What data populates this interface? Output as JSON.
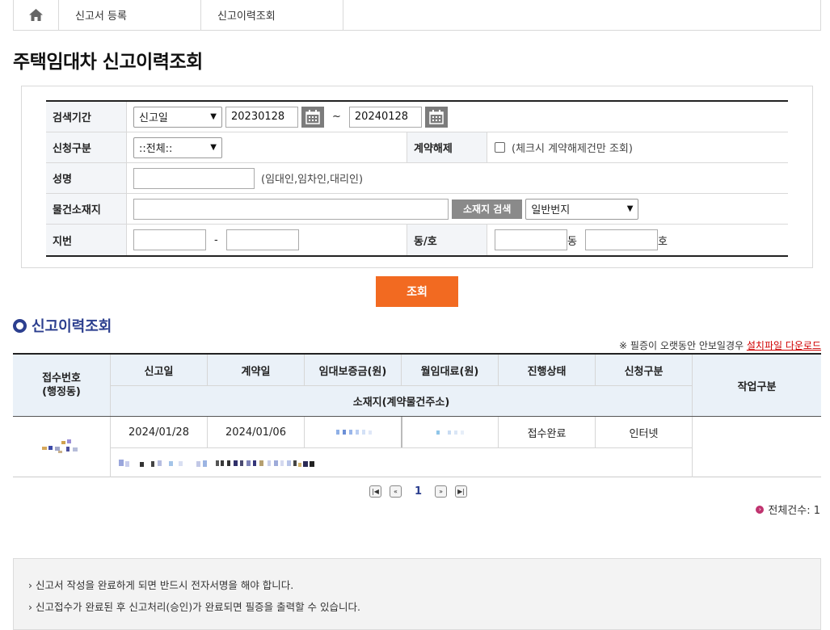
{
  "breadcrumb": {
    "items": [
      "신고서 등록",
      "신고이력조회"
    ]
  },
  "page_title": "주택임대차 신고이력조회",
  "search": {
    "period_label": "검색기간",
    "period_type": "신고일",
    "date_from": "20230128",
    "date_sep": "~",
    "date_to": "20240128",
    "apply_type_label": "신청구분",
    "apply_type_value": "::전체::",
    "cancel_label": "계약해제",
    "cancel_hint": "(체크시 계약해제건만 조회)",
    "name_label": "성명",
    "name_value": "",
    "name_hint": "(임대인,임차인,대리인)",
    "location_label": "물건소재지",
    "location_value": "",
    "location_search_btn": "소재지 검색",
    "lot_type": "일반번지",
    "lot_label": "지번",
    "lot_main": "",
    "lot_sep": "-",
    "lot_sub": "",
    "dongho_label": "동/호",
    "dong_value": "",
    "dong_unit": "동",
    "ho_value": "",
    "ho_unit": "호"
  },
  "search_button": "조회",
  "results": {
    "section_title": "신고이력조회",
    "notice_prefix": "※ 필증이 오랫동안 안보일경우",
    "notice_link": "설치파일 다운로드",
    "columns": {
      "receipt": "접수번호\n(행정동)",
      "report_date": "신고일",
      "contract_date": "계약일",
      "deposit": "임대보증금(원)",
      "rent": "월임대료(원)",
      "status": "진행상태",
      "apply_type": "신청구분",
      "address": "소재지(계약물건주소)",
      "action": "작업구분"
    },
    "rows": [
      {
        "report_date": "2024/01/28",
        "contract_date": "2024/01/06",
        "status": "접수완료",
        "apply_type": "인터넷"
      }
    ]
  },
  "pagination": {
    "current": "1"
  },
  "total_label": "전체건수: 1",
  "info": [
    "› 신고서 작성을 완료하게 되면 반드시 전자서명을 해야 합니다.",
    "› 신고접수가 완료된 후 신고처리(승인)가 완료되면 필증을 출력할 수 있습니다."
  ],
  "colors": {
    "accent": "#f26a21",
    "title_blue": "#2c3f8f",
    "header_bg": "#eaf1f8"
  }
}
